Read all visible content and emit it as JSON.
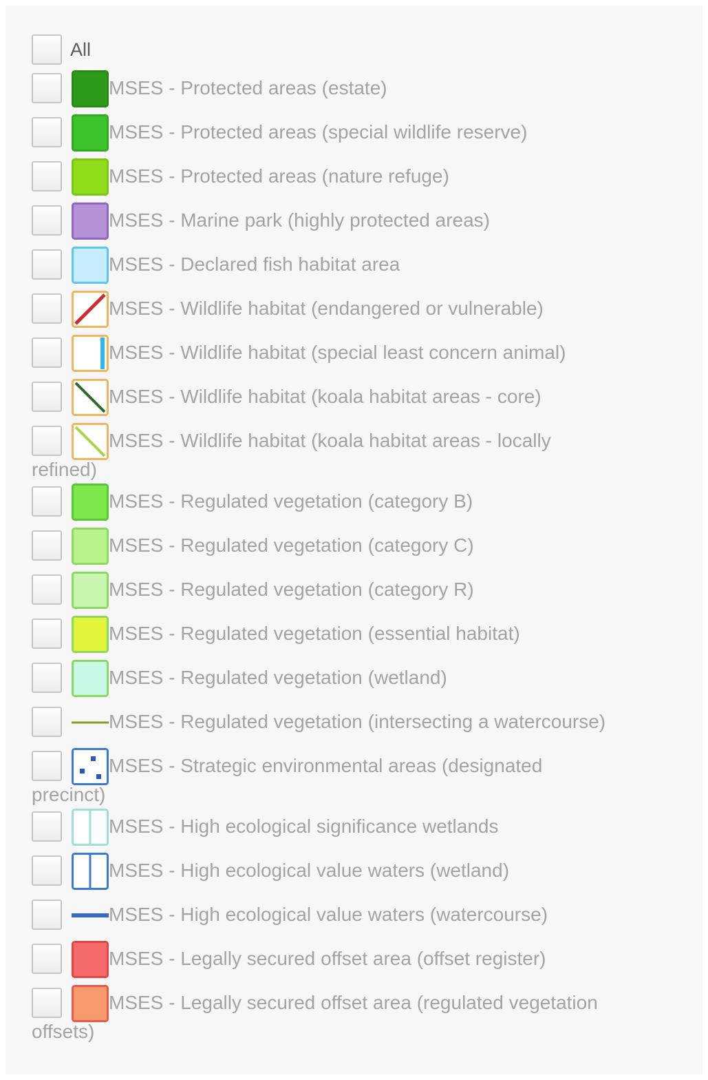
{
  "all_label": "All",
  "items": [
    {
      "label": "MSES - Protected areas (estate)",
      "swatch": "solid",
      "fill": "#2e9a1c",
      "border": "#2a8a18",
      "icon": "swatch-estate"
    },
    {
      "label": "MSES - Protected areas (special wildlife reserve)",
      "swatch": "solid",
      "fill": "#3cc42a",
      "border": "#33aa22",
      "icon": "swatch-special-wildlife-reserve"
    },
    {
      "label": "MSES - Protected areas (nature refuge)",
      "swatch": "solid",
      "fill": "#8fdd1a",
      "border": "#7cc416",
      "icon": "swatch-nature-refuge"
    },
    {
      "label": "MSES - Marine park (highly protected areas)",
      "swatch": "solid",
      "fill": "#b592d6",
      "border": "#8f65bf",
      "icon": "swatch-marine-park"
    },
    {
      "label": "MSES - Declared fish habitat area",
      "swatch": "solid",
      "fill": "#c8ecff",
      "border": "#5cc3f2",
      "icon": "swatch-fish-habitat"
    },
    {
      "label": "MSES - Wildlife habitat (endangered or vulnerable)",
      "swatch": "hatch-red",
      "fill": "#ffffff",
      "border": "#f2b45c",
      "icon": "swatch-endangered-vulnerable"
    },
    {
      "label": "MSES - Wildlife habitat (special least concern animal)",
      "swatch": "bar-blue",
      "fill": "#ffffff",
      "border": "#f2b45c",
      "icon": "swatch-special-least-concern"
    },
    {
      "label": "MSES - Wildlife habitat (koala habitat areas - core)",
      "swatch": "hatch-dark",
      "fill": "#ffffff",
      "border": "#f2b45c",
      "icon": "swatch-koala-core"
    },
    {
      "label": "MSES - Wildlife habitat (koala habitat areas - locally",
      "label2": "refined)",
      "swatch": "hatch-light",
      "fill": "#ffffff",
      "border": "#f2b45c",
      "icon": "swatch-koala-locally-refined"
    },
    {
      "label": "MSES - Regulated vegetation (category B)",
      "swatch": "solid",
      "fill": "#7ce84a",
      "border": "#5cc43a",
      "icon": "swatch-category-b"
    },
    {
      "label": "MSES - Regulated vegetation (category C)",
      "swatch": "solid",
      "fill": "#b8f28a",
      "border": "#8cd862",
      "icon": "swatch-category-c"
    },
    {
      "label": "MSES - Regulated vegetation (category R)",
      "swatch": "solid",
      "fill": "#c8f5b0",
      "border": "#8cd862",
      "icon": "swatch-category-r"
    },
    {
      "label": "MSES - Regulated vegetation (essential habitat)",
      "swatch": "solid",
      "fill": "#e2f53a",
      "border": "#8cd862",
      "icon": "swatch-essential-habitat"
    },
    {
      "label": "MSES - Regulated vegetation (wetland)",
      "swatch": "solid",
      "fill": "#c8f8e6",
      "border": "#8cd862",
      "icon": "swatch-wetland"
    },
    {
      "label": "MSES - Regulated vegetation (intersecting a watercourse)",
      "swatch": "line-olive",
      "fill": "none",
      "border": "none",
      "icon": "swatch-intersecting-watercourse"
    },
    {
      "label": "MSES - Strategic environmental areas (designated",
      "label2": "precinct)",
      "swatch": "dots-blue",
      "fill": "#ffffff",
      "border": "#3a7ad6",
      "icon": "swatch-designated-precinct"
    },
    {
      "label": "MSES - High ecological significance wetlands",
      "swatch": "grid-teal",
      "fill": "#ffffff",
      "border": "#9ee0d2",
      "icon": "swatch-hes-wetlands"
    },
    {
      "label": "MSES - High ecological value waters (wetland)",
      "swatch": "grid-blue",
      "fill": "#ffffff",
      "border": "#3a7ad6",
      "icon": "swatch-hev-wetland"
    },
    {
      "label": "MSES - High ecological value waters (watercourse)",
      "swatch": "line-blue",
      "fill": "none",
      "border": "none",
      "icon": "swatch-hev-watercourse"
    },
    {
      "label": "MSES - Legally secured offset area (offset register)",
      "swatch": "solid",
      "fill": "#f56a6a",
      "border": "#e04848",
      "icon": "swatch-offset-register"
    },
    {
      "label": "MSES - Legally secured offset area (regulated vegetation",
      "label2": "offsets)",
      "swatch": "solid",
      "fill": "#f79b6e",
      "border": "#e85a4a",
      "icon": "swatch-regulated-vegetation-offsets"
    }
  ]
}
